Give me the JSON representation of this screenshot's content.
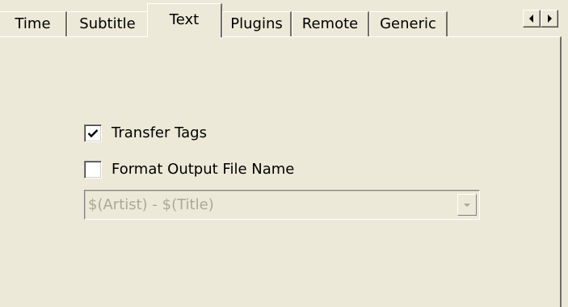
{
  "tabs": [
    {
      "label": "Time"
    },
    {
      "label": "Subtitle"
    },
    {
      "label": "Text",
      "active": true
    },
    {
      "label": "Plugins"
    },
    {
      "label": "Remote"
    },
    {
      "label": "Generic"
    }
  ],
  "scroll": {
    "left_icon": "triangle-left-icon",
    "right_icon": "triangle-right-icon"
  },
  "options": {
    "transfer_tags": {
      "label": "Transfer Tags",
      "checked": true
    },
    "format_output": {
      "label": "Format Output File Name",
      "checked": false
    }
  },
  "format_combo": {
    "value": "$(Artist) - $(Title)",
    "enabled": false,
    "icon": "chevron-down-icon"
  }
}
